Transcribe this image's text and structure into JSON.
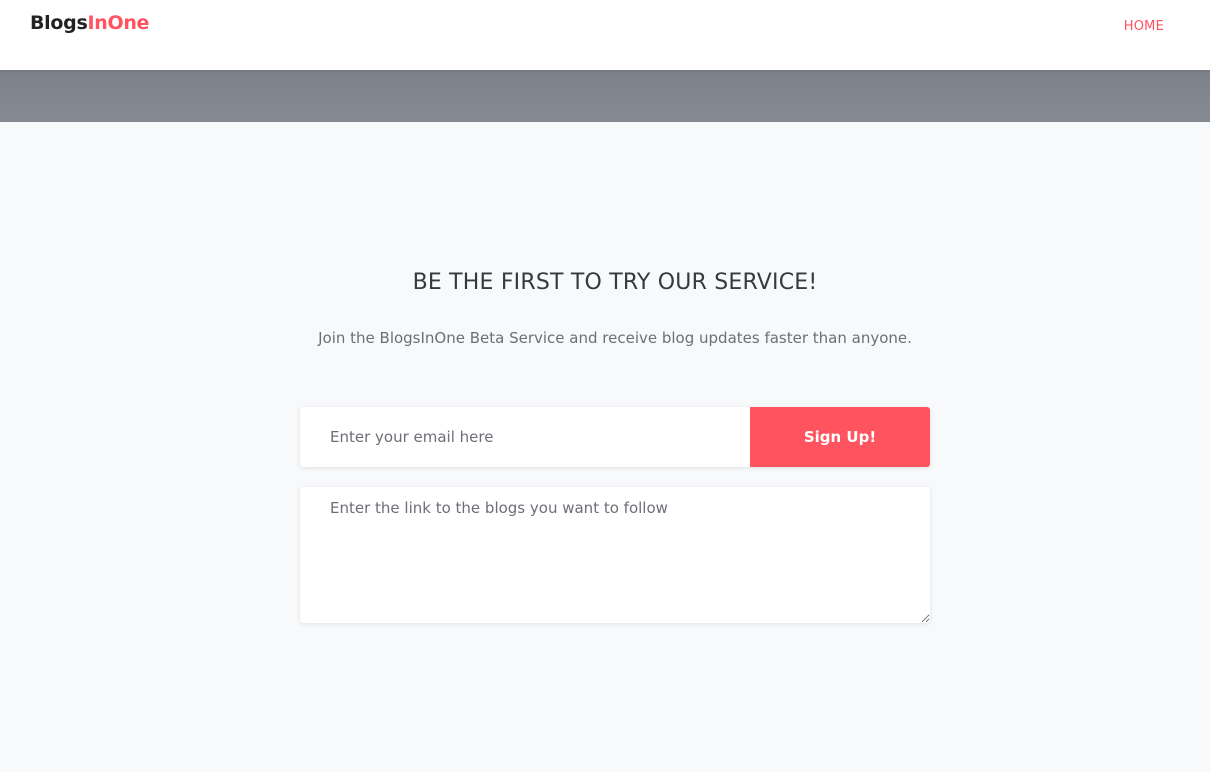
{
  "brand": {
    "part1": "Blogs",
    "part2": "InOne",
    "accent_color": "#ff5360"
  },
  "nav": {
    "home_label": "HOME"
  },
  "signup": {
    "heading": "BE THE FIRST TO TRY OUR SERVICE!",
    "subheading": "Join the BlogsInOne Beta Service and receive blog updates faster than anyone.",
    "email_placeholder": "Enter your email here",
    "button_label": "Sign Up!",
    "blogs_placeholder": "Enter the link to the blogs you want to follow"
  }
}
